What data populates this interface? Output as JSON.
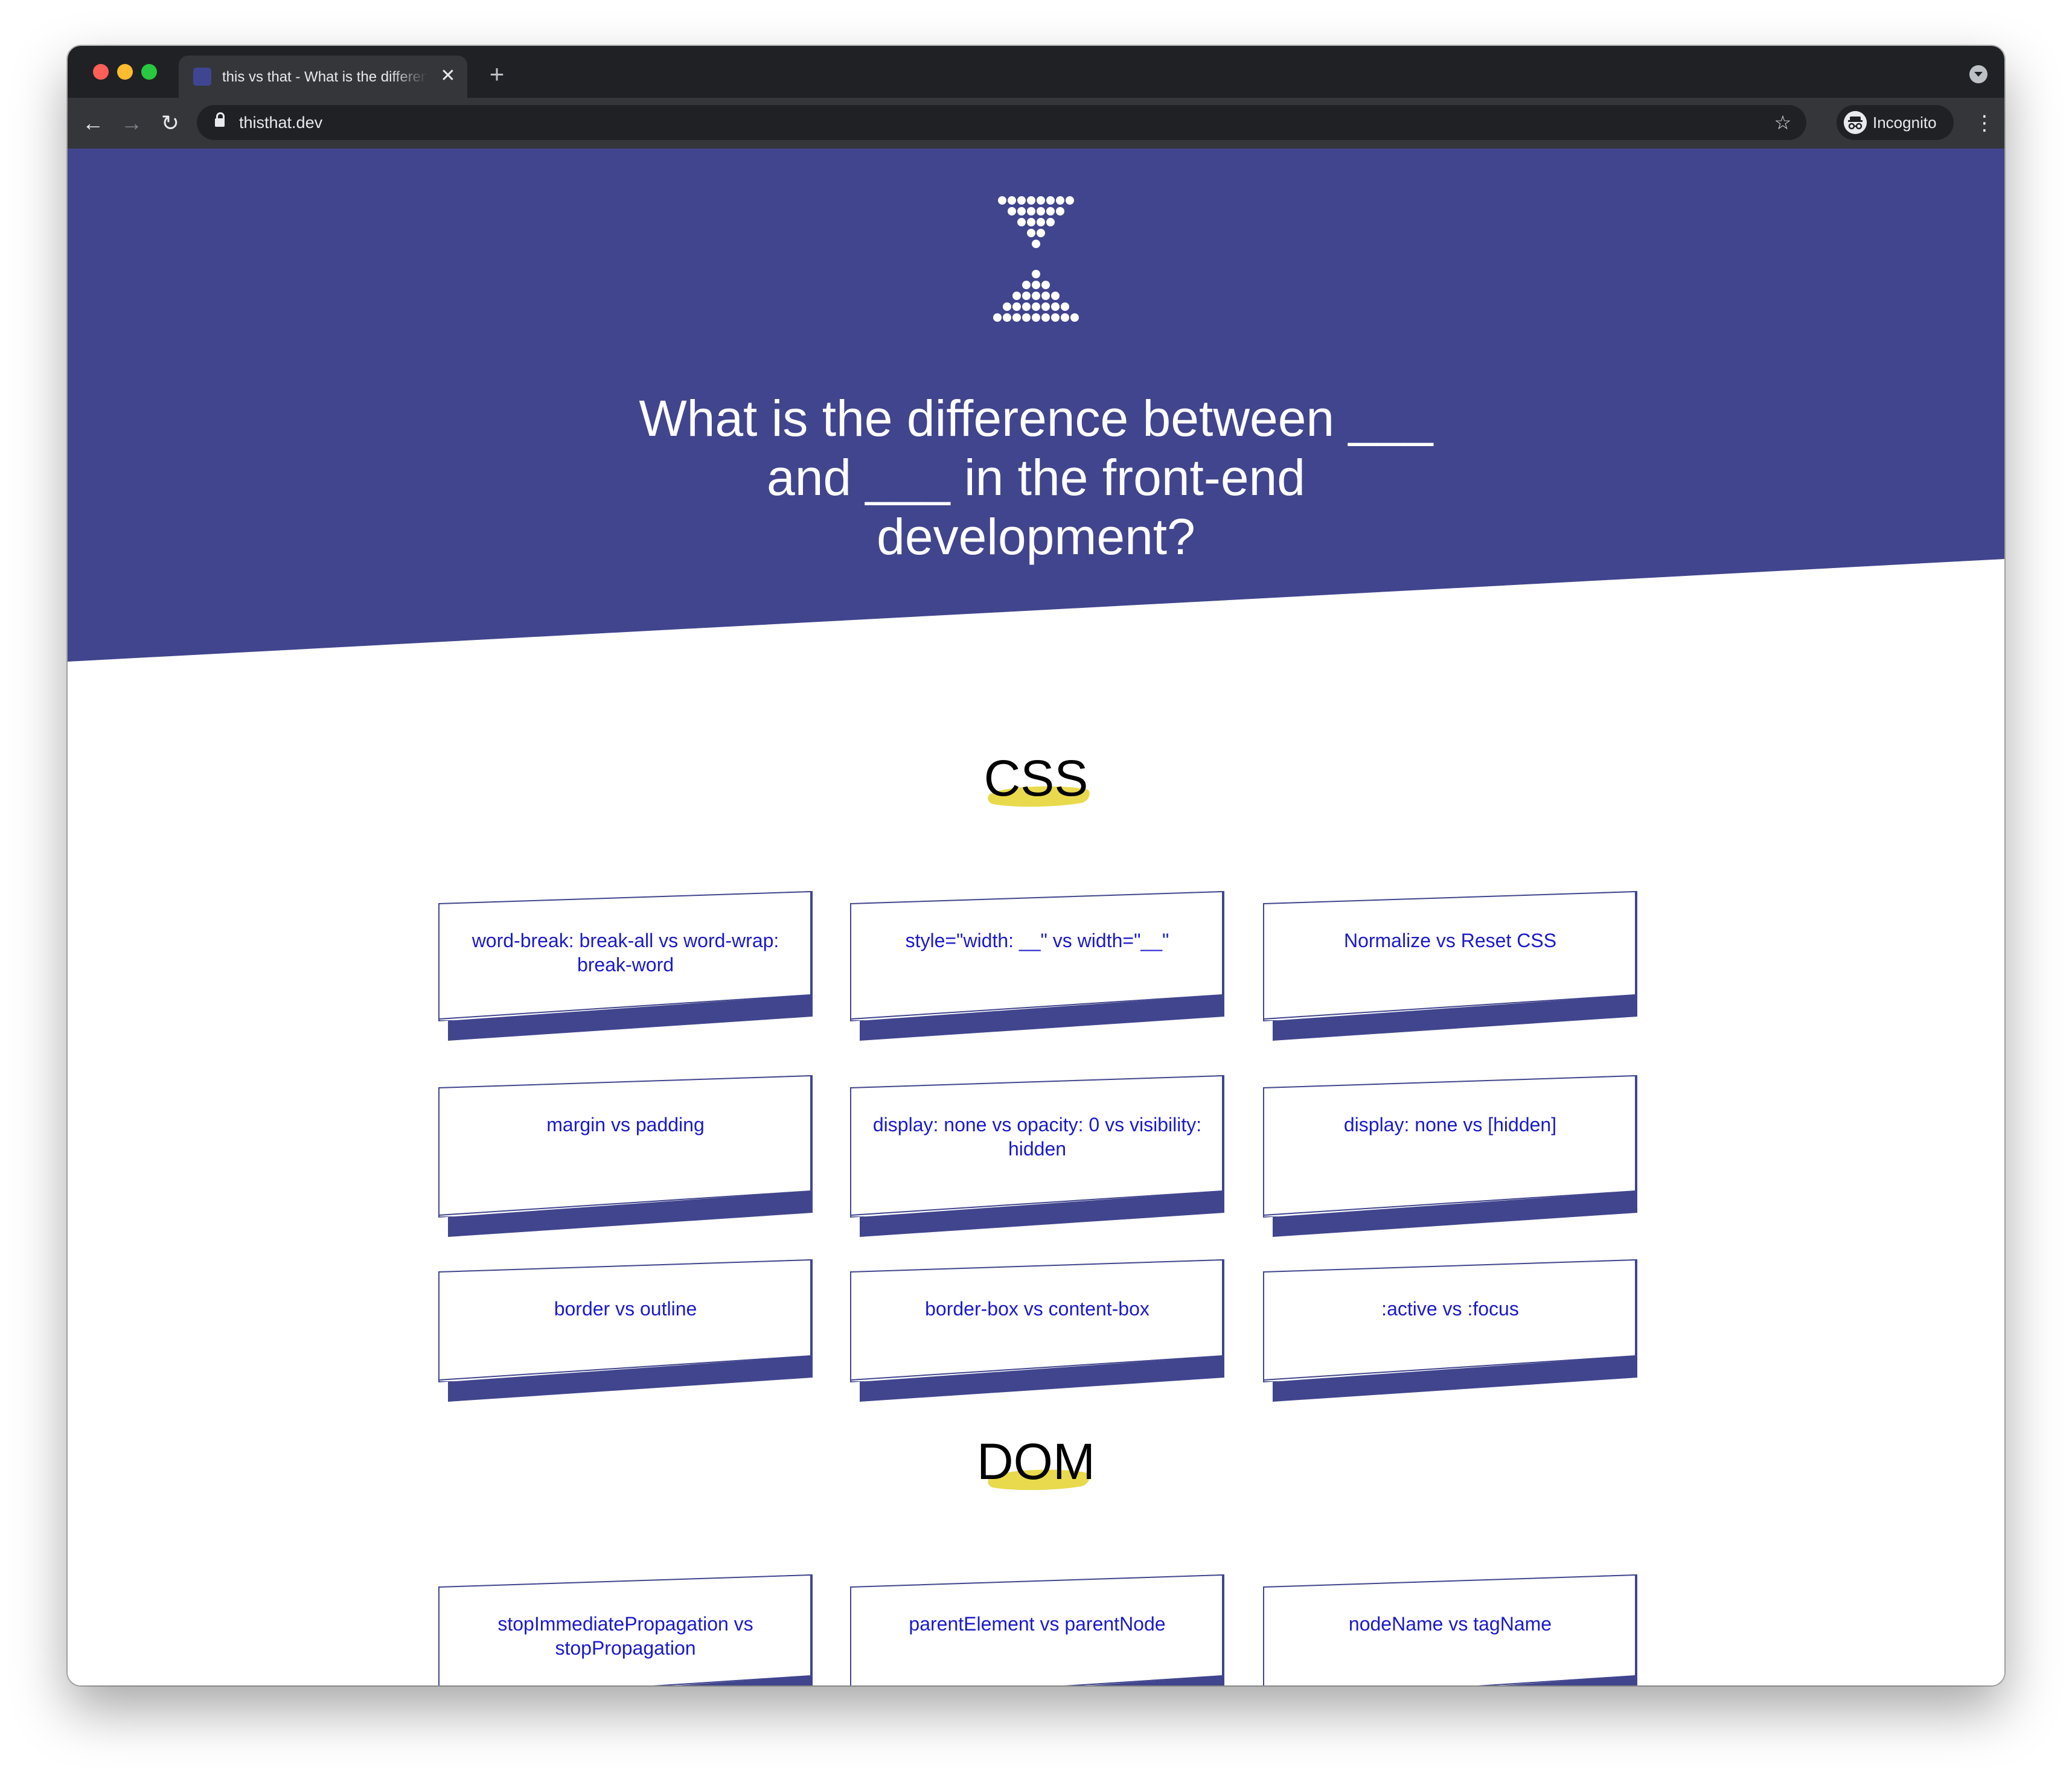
{
  "browser": {
    "tab_title": "this vs that - What is the difference between __ and __ in the front-end development?",
    "url": "thisthat.dev",
    "incognito_label": "Incognito",
    "close_glyph": "✕",
    "newtab_glyph": "+",
    "back_glyph": "←",
    "forward_glyph": "→",
    "reload_glyph": "↻",
    "star_glyph": "☆",
    "menu_glyph": "⋮",
    "incognito_glyph": "◉◉"
  },
  "hero": {
    "title": "What is the difference between ___ and ___ in the front-end development?",
    "background": "#41458d"
  },
  "accent": {
    "highlight": "#e8da4c",
    "link": "#1a1acc",
    "card_shadow": "#41458d"
  },
  "sections": [
    {
      "title": "CSS",
      "cards": [
        "word-break: break-all vs word-wrap: break-word",
        "style=\"width: __\" vs width=\"__\"",
        "Normalize vs Reset CSS",
        "margin vs padding",
        "display: none vs opacity: 0 vs visibility: hidden",
        "display: none vs [hidden]",
        "border vs outline",
        "border-box vs content-box",
        ":active vs :focus"
      ]
    },
    {
      "title": "DOM",
      "cards": [
        "stopImmediatePropagation vs stopPropagation",
        "parentElement vs parentNode",
        "nodeName vs tagName"
      ]
    }
  ]
}
